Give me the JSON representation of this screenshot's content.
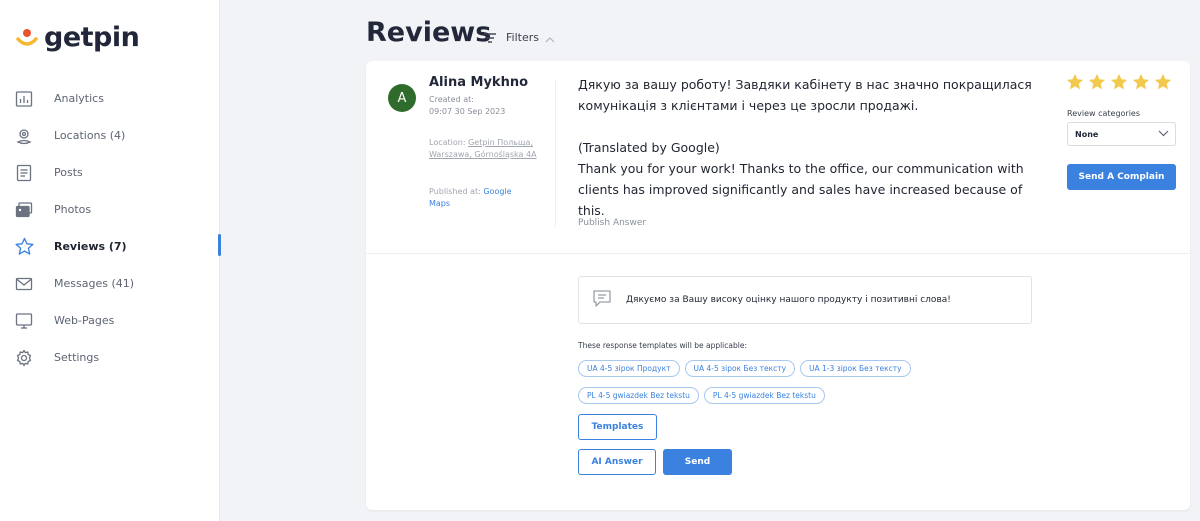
{
  "brand": {
    "name": "getpin"
  },
  "sidebar": {
    "items": [
      {
        "label": "Analytics",
        "icon": "bar-chart-icon",
        "active": false
      },
      {
        "label": "Locations (4)",
        "icon": "location-pin-icon",
        "active": false
      },
      {
        "label": "Posts",
        "icon": "document-icon",
        "active": false
      },
      {
        "label": "Photos",
        "icon": "photos-icon",
        "active": false
      },
      {
        "label": "Reviews (7)",
        "icon": "star-icon",
        "active": true
      },
      {
        "label": "Messages (41)",
        "icon": "envelope-icon",
        "active": false
      },
      {
        "label": "Web-Pages",
        "icon": "monitor-icon",
        "active": false
      },
      {
        "label": "Settings",
        "icon": "gear-icon",
        "active": false
      }
    ]
  },
  "header": {
    "title": "Reviews",
    "filters_label": "Filters"
  },
  "review": {
    "avatar_initial": "A",
    "avatar_color": "#2f6b2b",
    "author": "Alina Mykhno",
    "created_label": "Created at:",
    "created_value": "09:07 30 Sep 2023",
    "location_prefix": "Location: ",
    "location_value": "Getpin Польща, Warszawa, Górnośląska 4A",
    "published_prefix": "Published at: ",
    "published_value": "Google Maps",
    "text_original_1": "Дякую за вашу роботу! Завдяки кабінету в нас значно покращилася",
    "text_original_2": "комунікація з клієнтами і через це зросли продажі.",
    "text_translated_label": "(Translated by Google)",
    "text_translated_1": "Thank you for your work! Thanks to the office, our communication with",
    "text_translated_2": "clients has improved significantly and sales have increased because of this.",
    "publish_answer": "Publish Answer",
    "rating": 5,
    "star_color": "#f2c94c",
    "categories_label": "Review categories",
    "category_selected": "None",
    "complain_label": "Send A Complain"
  },
  "answer": {
    "text": "Дякуємо за Вашу високу оцінку нашого продукту і позитивні слова!",
    "templates_hint": "These response templates will be applicable:",
    "chips_row1": [
      "UA 4-5 зірок Продукт",
      "UA 4-5 зірок Без тексту",
      "UA 1-3 зірок Без тексту"
    ],
    "chips_row2": [
      "PL 4-5 gwiazdek Bez tekstu",
      "PL 4-5 gwiazdek Bez tekstu"
    ],
    "templates_button": "Templates",
    "ai_button": "AI Answer",
    "send_button": "Send"
  },
  "colors": {
    "accent": "#3b82e0",
    "logo_orange": "#e8552d",
    "logo_yellow": "#f5b82e"
  }
}
